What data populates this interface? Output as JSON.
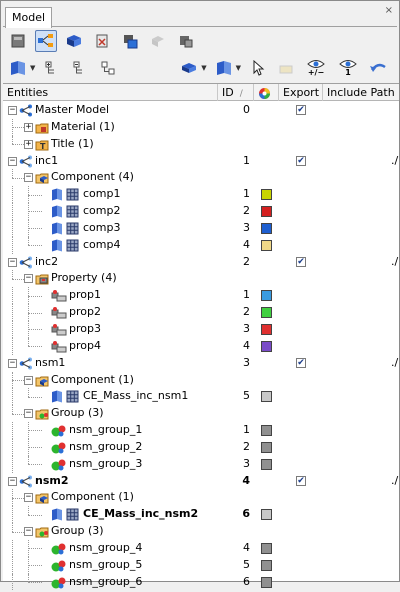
{
  "tab": {
    "label": "Model",
    "close": "×"
  },
  "toolbar1": [
    {
      "icon": "db-icon"
    },
    {
      "icon": "model-tree-icon"
    },
    {
      "icon": "component-view-icon"
    },
    {
      "icon": "clear-icon"
    },
    {
      "icon": "import-icon"
    },
    {
      "icon": "include-dim-icon"
    },
    {
      "icon": "solver-icon"
    }
  ],
  "toolbar2": {
    "eye_plusminus": "+/−",
    "eye_one": "1"
  },
  "columns": {
    "entities": "Entities",
    "id": "ID",
    "sort": "/",
    "export": "Export",
    "include_path": "Include Path"
  },
  "rows": [
    {
      "level": 0,
      "toggle": "−",
      "icon": "model",
      "name": "Master Model",
      "id": "0",
      "export": true,
      "path": ""
    },
    {
      "level": 1,
      "toggle": "+",
      "icon": "material",
      "name": "Material (1)"
    },
    {
      "level": 1,
      "toggle": "+",
      "icon": "title",
      "name": "Title (1)"
    },
    {
      "level": 0,
      "toggle": "−",
      "icon": "include",
      "name": "inc1",
      "id": "1",
      "export": true,
      "path": "./"
    },
    {
      "level": 1,
      "toggle": "−",
      "icon": "component-folder",
      "name": "Component (4)"
    },
    {
      "level": 2,
      "icon": "component",
      "name": "comp1",
      "id": "1",
      "color": "#c8d400"
    },
    {
      "level": 2,
      "icon": "component",
      "name": "comp2",
      "id": "2",
      "color": "#d42020"
    },
    {
      "level": 2,
      "icon": "component",
      "name": "comp3",
      "id": "3",
      "color": "#1e5fd0"
    },
    {
      "level": 2,
      "icon": "component",
      "name": "comp4",
      "id": "4",
      "color": "#f0d888"
    },
    {
      "level": 0,
      "toggle": "−",
      "icon": "include",
      "name": "inc2",
      "id": "2",
      "export": true,
      "path": "./"
    },
    {
      "level": 1,
      "toggle": "−",
      "icon": "property-folder",
      "name": "Property (4)"
    },
    {
      "level": 2,
      "icon": "property",
      "name": "prop1",
      "id": "1",
      "color": "#3a9be0"
    },
    {
      "level": 2,
      "icon": "property",
      "name": "prop2",
      "id": "2",
      "color": "#40d040"
    },
    {
      "level": 2,
      "icon": "property",
      "name": "prop3",
      "id": "3",
      "color": "#e03030"
    },
    {
      "level": 2,
      "icon": "property",
      "name": "prop4",
      "id": "4",
      "color": "#7a4cc8"
    },
    {
      "level": 0,
      "toggle": "−",
      "icon": "include",
      "name": "nsm1",
      "id": "3",
      "export": true,
      "path": "./"
    },
    {
      "level": 1,
      "toggle": "−",
      "icon": "component-folder",
      "name": "Component (1)"
    },
    {
      "level": 2,
      "icon": "component",
      "name": "CE_Mass_inc_nsm1",
      "id": "5",
      "color": "#c8c8c8"
    },
    {
      "level": 1,
      "toggle": "−",
      "icon": "group-folder",
      "name": "Group (3)"
    },
    {
      "level": 2,
      "icon": "group",
      "name": "nsm_group_1",
      "id": "1",
      "color": "#909090"
    },
    {
      "level": 2,
      "icon": "group",
      "name": "nsm_group_2",
      "id": "2",
      "color": "#909090"
    },
    {
      "level": 2,
      "icon": "group",
      "name": "nsm_group_3",
      "id": "3",
      "color": "#909090"
    },
    {
      "level": 0,
      "toggle": "−",
      "icon": "include",
      "name": "nsm2",
      "id": "4",
      "export": true,
      "path": "./",
      "bold": true
    },
    {
      "level": 1,
      "toggle": "−",
      "icon": "component-folder",
      "name": "Component (1)"
    },
    {
      "level": 2,
      "icon": "component",
      "name": "CE_Mass_inc_nsm2",
      "id": "6",
      "color": "#c8c8c8",
      "bold": true
    },
    {
      "level": 1,
      "toggle": "−",
      "icon": "group-folder",
      "name": "Group (3)"
    },
    {
      "level": 2,
      "icon": "group",
      "name": "nsm_group_4",
      "id": "4",
      "color": "#909090"
    },
    {
      "level": 2,
      "icon": "group",
      "name": "nsm_group_5",
      "id": "5",
      "color": "#909090"
    },
    {
      "level": 2,
      "icon": "group",
      "name": "nsm_group_6",
      "id": "6",
      "color": "#909090"
    }
  ]
}
